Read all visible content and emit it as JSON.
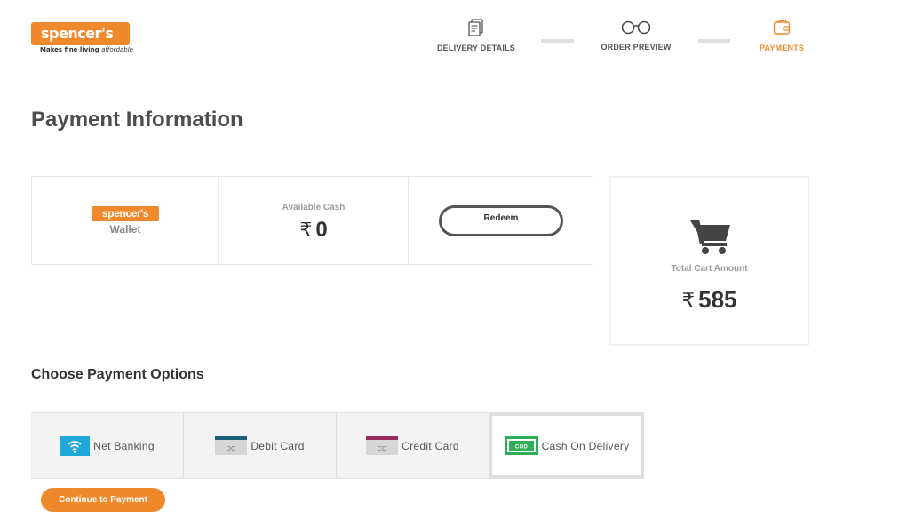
{
  "brand": {
    "logo_text": "spencer's",
    "tagline_prefix": "Makes fine living",
    "tagline_suffix": "affordable",
    "accent_color": "#f0892b"
  },
  "steps": [
    {
      "label": "DELIVERY DETAILS",
      "icon": "receipt-icon"
    },
    {
      "label": "ORDER PREVIEW",
      "icon": "glasses-icon"
    },
    {
      "label": "PAYMENTS",
      "icon": "wallet-icon",
      "active": true
    }
  ],
  "page_title": "Payment Information",
  "wallet": {
    "logo_text": "spencer's",
    "label": "Wallet",
    "available_label": "Available Cash",
    "currency": "₹",
    "available_amount": "0",
    "redeem_label": "Redeem"
  },
  "cart": {
    "label": "Total Cart Amount",
    "currency": "₹",
    "amount": "585"
  },
  "payment_section_title": "Choose Payment Options",
  "payment_options": [
    {
      "label": "Net Banking",
      "icon": "wifi-icon"
    },
    {
      "label": "Debit Card",
      "icon": "debit-card-icon",
      "icon_text": "DC"
    },
    {
      "label": "Credit Card",
      "icon": "credit-card-icon",
      "icon_text": "CC"
    },
    {
      "label": "Cash On Delivery",
      "icon": "cod-icon",
      "icon_text": "COD",
      "selected": true
    }
  ],
  "continue_label": "Continue to Payment"
}
